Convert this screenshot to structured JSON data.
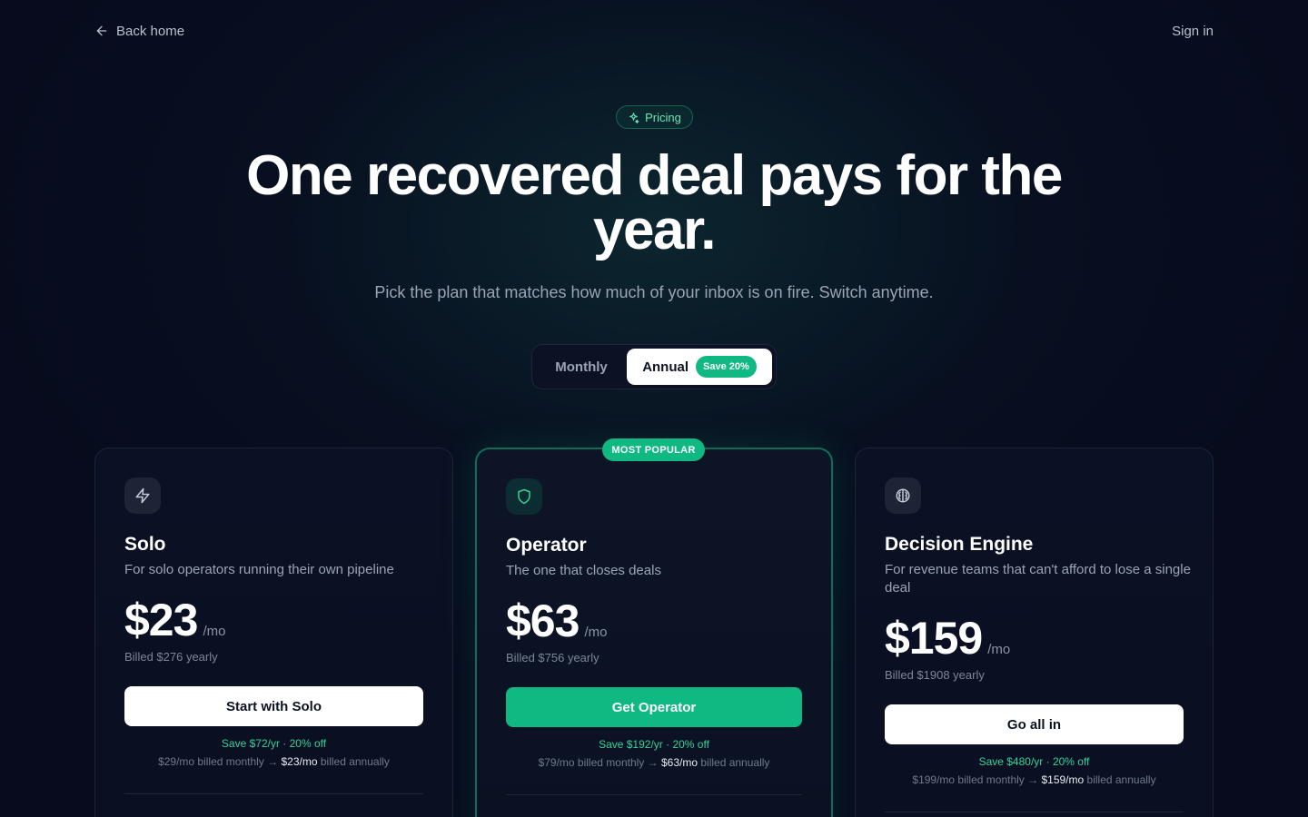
{
  "nav": {
    "back_label": "Back home",
    "signin_label": "Sign in"
  },
  "badge": {
    "label": "Pricing"
  },
  "hero": {
    "title": "One recovered deal pays for the year.",
    "subtitle": "Pick the plan that matches how much of your inbox is on fire. Switch anytime."
  },
  "billing_toggle": {
    "monthly_label": "Monthly",
    "annual_label": "Annual",
    "save_badge": "Save 20%",
    "selected": "Annual"
  },
  "popular_tag": "MOST POPULAR",
  "plans": [
    {
      "icon": "lightning-icon",
      "name": "Solo",
      "description": "For solo operators running their own pipeline",
      "price": "$23",
      "per": "/mo",
      "billed": "Billed $276 yearly",
      "cta": "Start with Solo",
      "savings": "Save $72/yr · 20% off",
      "compare_monthly": "$29/mo billed monthly →",
      "compare_annual": "$23/mo",
      "compare_suffix": "billed annually"
    },
    {
      "icon": "shield-icon",
      "name": "Operator",
      "description": "The one that closes deals",
      "price": "$63",
      "per": "/mo",
      "billed": "Billed $756 yearly",
      "cta": "Get Operator",
      "savings": "Save $192/yr · 20% off",
      "compare_monthly": "$79/mo billed monthly →",
      "compare_annual": "$63/mo",
      "compare_suffix": "billed annually"
    },
    {
      "icon": "brain-icon",
      "name": "Decision Engine",
      "description": "For revenue teams that can't afford to lose a single deal",
      "price": "$159",
      "per": "/mo",
      "billed": "Billed $1908 yearly",
      "cta": "Go all in",
      "savings": "Save $480/yr · 20% off",
      "compare_monthly": "$199/mo billed monthly →",
      "compare_annual": "$159/mo",
      "compare_suffix": "billed annually"
    }
  ],
  "colors": {
    "accent": "#10b981",
    "background": "#070b1d",
    "card": "#0b1124"
  }
}
